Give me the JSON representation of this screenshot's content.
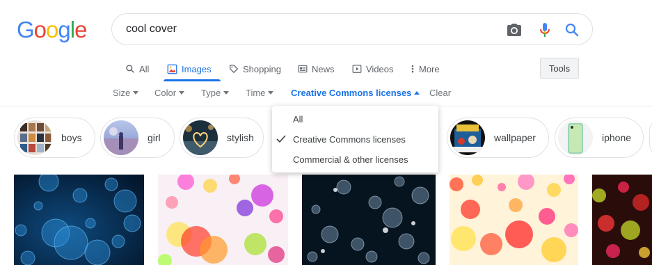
{
  "logo": {
    "letters": [
      "G",
      "o",
      "o",
      "g",
      "l",
      "e"
    ],
    "colors": [
      "#4285f4",
      "#ea4335",
      "#fbbc05",
      "#4285f4",
      "#34a853",
      "#ea4335"
    ]
  },
  "search": {
    "query": "cool cover",
    "icons": [
      "camera-icon",
      "microphone-icon",
      "search-icon"
    ]
  },
  "tabs": [
    {
      "label": "All",
      "icon": "search-icon"
    },
    {
      "label": "Images",
      "icon": "image-icon"
    },
    {
      "label": "Shopping",
      "icon": "tag-icon"
    },
    {
      "label": "News",
      "icon": "newspaper-icon"
    },
    {
      "label": "Videos",
      "icon": "play-icon"
    },
    {
      "label": "More",
      "icon": "vertical-dots-icon"
    }
  ],
  "tools_label": "Tools",
  "filters": {
    "size": "Size",
    "color": "Color",
    "type": "Type",
    "time": "Time",
    "license": "Creative Commons licenses",
    "clear": "Clear"
  },
  "chips": [
    {
      "label": "boys"
    },
    {
      "label": "girl"
    },
    {
      "label": "stylish"
    },
    {
      "label": "wallpaper"
    },
    {
      "label": "iphone"
    }
  ],
  "license_menu": {
    "items": [
      {
        "label": "All",
        "checked": false
      },
      {
        "label": "Creative Commons licenses",
        "checked": true
      },
      {
        "label": "Commercial & other licenses",
        "checked": false
      }
    ]
  },
  "colors": {
    "accent": "#1a73e8",
    "muted": "#70757a"
  }
}
